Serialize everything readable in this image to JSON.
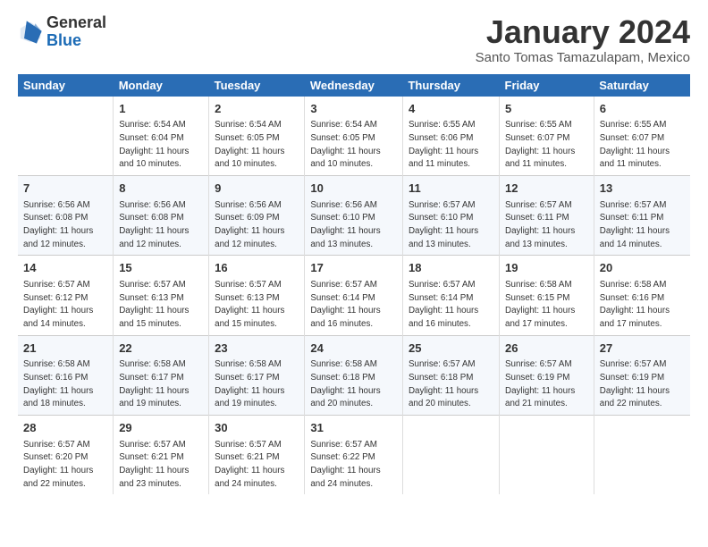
{
  "logo": {
    "general": "General",
    "blue": "Blue"
  },
  "title": "January 2024",
  "subtitle": "Santo Tomas Tamazulapam, Mexico",
  "headers": [
    "Sunday",
    "Monday",
    "Tuesday",
    "Wednesday",
    "Thursday",
    "Friday",
    "Saturday"
  ],
  "weeks": [
    [
      {
        "day": "",
        "info": ""
      },
      {
        "day": "1",
        "info": "Sunrise: 6:54 AM\nSunset: 6:04 PM\nDaylight: 11 hours and 10 minutes."
      },
      {
        "day": "2",
        "info": "Sunrise: 6:54 AM\nSunset: 6:05 PM\nDaylight: 11 hours and 10 minutes."
      },
      {
        "day": "3",
        "info": "Sunrise: 6:54 AM\nSunset: 6:05 PM\nDaylight: 11 hours and 10 minutes."
      },
      {
        "day": "4",
        "info": "Sunrise: 6:55 AM\nSunset: 6:06 PM\nDaylight: 11 hours and 11 minutes."
      },
      {
        "day": "5",
        "info": "Sunrise: 6:55 AM\nSunset: 6:07 PM\nDaylight: 11 hours and 11 minutes."
      },
      {
        "day": "6",
        "info": "Sunrise: 6:55 AM\nSunset: 6:07 PM\nDaylight: 11 hours and 11 minutes."
      }
    ],
    [
      {
        "day": "7",
        "info": "Sunrise: 6:56 AM\nSunset: 6:08 PM\nDaylight: 11 hours and 12 minutes."
      },
      {
        "day": "8",
        "info": "Sunrise: 6:56 AM\nSunset: 6:08 PM\nDaylight: 11 hours and 12 minutes."
      },
      {
        "day": "9",
        "info": "Sunrise: 6:56 AM\nSunset: 6:09 PM\nDaylight: 11 hours and 12 minutes."
      },
      {
        "day": "10",
        "info": "Sunrise: 6:56 AM\nSunset: 6:10 PM\nDaylight: 11 hours and 13 minutes."
      },
      {
        "day": "11",
        "info": "Sunrise: 6:57 AM\nSunset: 6:10 PM\nDaylight: 11 hours and 13 minutes."
      },
      {
        "day": "12",
        "info": "Sunrise: 6:57 AM\nSunset: 6:11 PM\nDaylight: 11 hours and 13 minutes."
      },
      {
        "day": "13",
        "info": "Sunrise: 6:57 AM\nSunset: 6:11 PM\nDaylight: 11 hours and 14 minutes."
      }
    ],
    [
      {
        "day": "14",
        "info": "Sunrise: 6:57 AM\nSunset: 6:12 PM\nDaylight: 11 hours and 14 minutes."
      },
      {
        "day": "15",
        "info": "Sunrise: 6:57 AM\nSunset: 6:13 PM\nDaylight: 11 hours and 15 minutes."
      },
      {
        "day": "16",
        "info": "Sunrise: 6:57 AM\nSunset: 6:13 PM\nDaylight: 11 hours and 15 minutes."
      },
      {
        "day": "17",
        "info": "Sunrise: 6:57 AM\nSunset: 6:14 PM\nDaylight: 11 hours and 16 minutes."
      },
      {
        "day": "18",
        "info": "Sunrise: 6:57 AM\nSunset: 6:14 PM\nDaylight: 11 hours and 16 minutes."
      },
      {
        "day": "19",
        "info": "Sunrise: 6:58 AM\nSunset: 6:15 PM\nDaylight: 11 hours and 17 minutes."
      },
      {
        "day": "20",
        "info": "Sunrise: 6:58 AM\nSunset: 6:16 PM\nDaylight: 11 hours and 17 minutes."
      }
    ],
    [
      {
        "day": "21",
        "info": "Sunrise: 6:58 AM\nSunset: 6:16 PM\nDaylight: 11 hours and 18 minutes."
      },
      {
        "day": "22",
        "info": "Sunrise: 6:58 AM\nSunset: 6:17 PM\nDaylight: 11 hours and 19 minutes."
      },
      {
        "day": "23",
        "info": "Sunrise: 6:58 AM\nSunset: 6:17 PM\nDaylight: 11 hours and 19 minutes."
      },
      {
        "day": "24",
        "info": "Sunrise: 6:58 AM\nSunset: 6:18 PM\nDaylight: 11 hours and 20 minutes."
      },
      {
        "day": "25",
        "info": "Sunrise: 6:57 AM\nSunset: 6:18 PM\nDaylight: 11 hours and 20 minutes."
      },
      {
        "day": "26",
        "info": "Sunrise: 6:57 AM\nSunset: 6:19 PM\nDaylight: 11 hours and 21 minutes."
      },
      {
        "day": "27",
        "info": "Sunrise: 6:57 AM\nSunset: 6:19 PM\nDaylight: 11 hours and 22 minutes."
      }
    ],
    [
      {
        "day": "28",
        "info": "Sunrise: 6:57 AM\nSunset: 6:20 PM\nDaylight: 11 hours and 22 minutes."
      },
      {
        "day": "29",
        "info": "Sunrise: 6:57 AM\nSunset: 6:21 PM\nDaylight: 11 hours and 23 minutes."
      },
      {
        "day": "30",
        "info": "Sunrise: 6:57 AM\nSunset: 6:21 PM\nDaylight: 11 hours and 24 minutes."
      },
      {
        "day": "31",
        "info": "Sunrise: 6:57 AM\nSunset: 6:22 PM\nDaylight: 11 hours and 24 minutes."
      },
      {
        "day": "",
        "info": ""
      },
      {
        "day": "",
        "info": ""
      },
      {
        "day": "",
        "info": ""
      }
    ]
  ]
}
